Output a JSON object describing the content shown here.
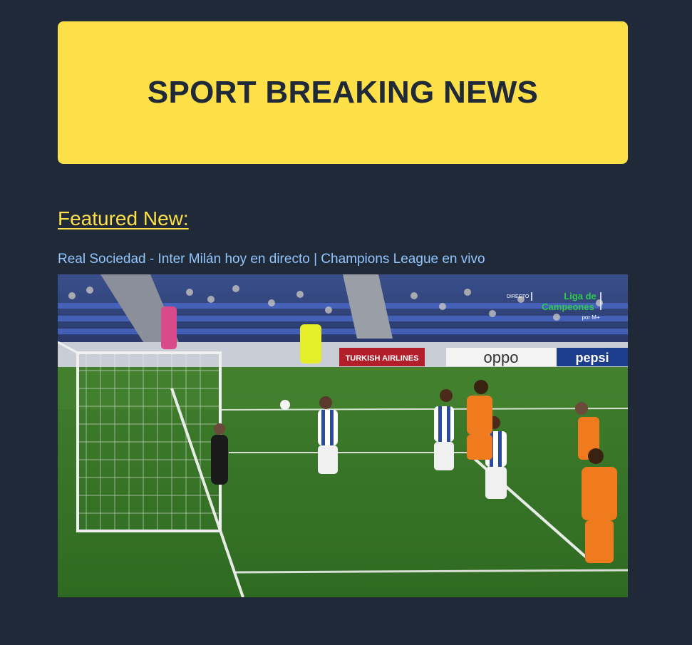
{
  "header": {
    "title": "SPORT BREAKING NEWS"
  },
  "featured": {
    "heading": "Featured New:",
    "article": {
      "title": "Real Sociedad - Inter Milán hoy en directo | Champions League en vivo",
      "image": {
        "overlay_live": "DIRECTO",
        "overlay_competition_line1": "Liga de",
        "overlay_competition_line2": "Campeones",
        "overlay_broadcaster": "por M+",
        "board_ads": [
          "TURKISH AIRLINES",
          "oppo",
          "pepsi"
        ]
      }
    }
  },
  "colors": {
    "page_background": "#1f2937",
    "banner_background": "#fde047",
    "banner_text": "#1f2937",
    "heading_text": "#fde047",
    "link_text": "#93c5fd"
  }
}
